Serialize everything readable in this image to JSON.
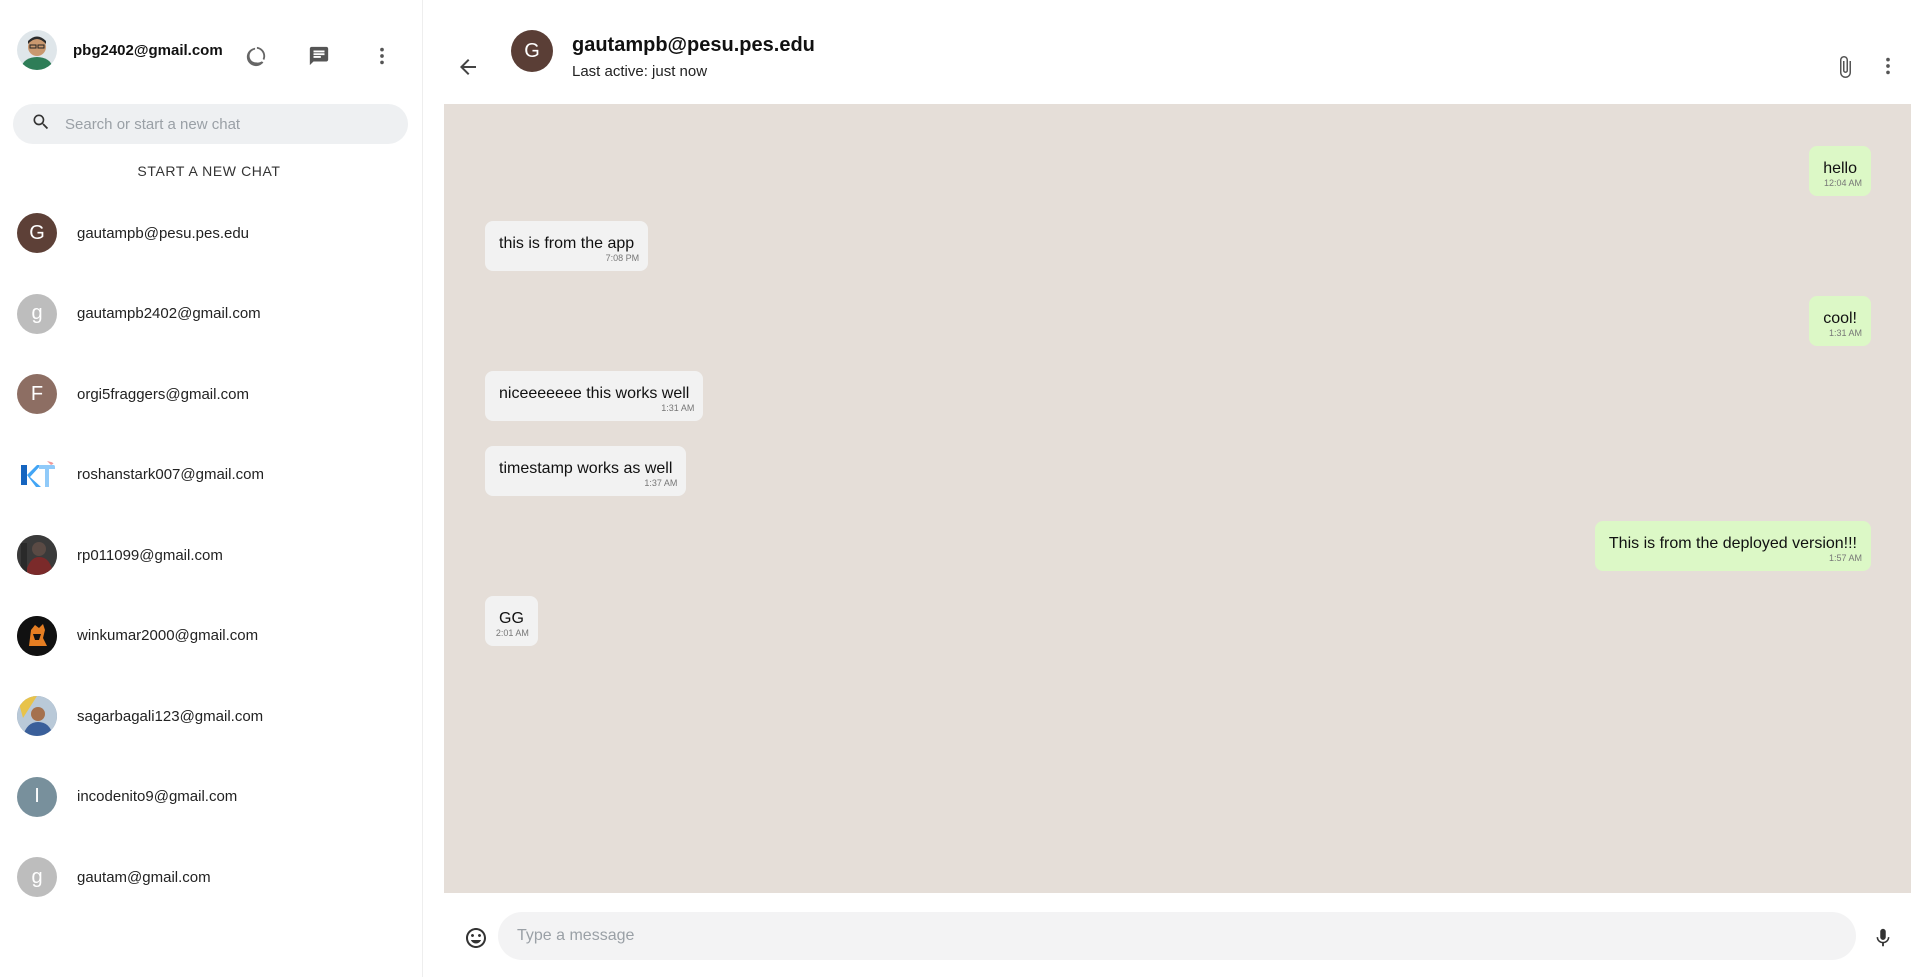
{
  "sidebar": {
    "user_email": "pbg2402@gmail.com",
    "search_placeholder": "Search or start a new chat",
    "new_chat_label": "START A NEW CHAT",
    "chats": [
      {
        "email": "gautampb@pesu.pes.edu",
        "initial": "G",
        "color": "#5d4037"
      },
      {
        "email": "gautampb2402@gmail.com",
        "initial": "g",
        "color": "#bdbdbd"
      },
      {
        "email": "orgi5fraggers@gmail.com",
        "initial": "F",
        "color": "#8d6e63"
      },
      {
        "email": "roshanstark007@gmail.com",
        "initial": "",
        "color": "#ffffff"
      },
      {
        "email": "rp011099@gmail.com",
        "initial": "",
        "color": "#4a4a4a"
      },
      {
        "email": "winkumar2000@gmail.com",
        "initial": "",
        "color": "#111111"
      },
      {
        "email": "sagarbagali123@gmail.com",
        "initial": "",
        "color": "#7a8aa0"
      },
      {
        "email": "incodenito9@gmail.com",
        "initial": "I",
        "color": "#78909c"
      },
      {
        "email": "gautam@gmail.com",
        "initial": "g",
        "color": "#bdbdbd"
      }
    ]
  },
  "header": {
    "peer_initial": "G",
    "peer_email": "gautampb@pesu.pes.edu",
    "status": "Last active: just now"
  },
  "messages": [
    {
      "text": "hello",
      "time": "12:04 AM",
      "dir": "out"
    },
    {
      "text": "this is from the app",
      "time": "7:08 PM",
      "dir": "in"
    },
    {
      "text": "cool!",
      "time": "1:31 AM",
      "dir": "out"
    },
    {
      "text": "niceeeeeee this works well",
      "time": "1:31 AM",
      "dir": "in"
    },
    {
      "text": "timestamp works as well",
      "time": "1:37 AM",
      "dir": "in"
    },
    {
      "text": "This is from the deployed version!!!",
      "time": "1:57 AM",
      "dir": "out"
    },
    {
      "text": "GG",
      "time": "2:01 AM",
      "dir": "in"
    }
  ],
  "composer": {
    "placeholder": "Type a message"
  }
}
